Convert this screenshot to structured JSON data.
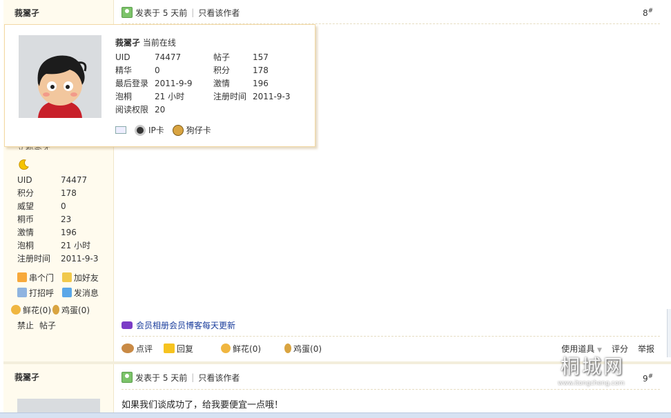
{
  "post1": {
    "author": "莪翯孑",
    "posted": "发表于 5 天前",
    "only_author": "只看该作者",
    "floor_num": "8",
    "floor_mark": "#",
    "cut_text": "丈都秀才",
    "stats": [
      {
        "k": "UID",
        "v": "74477"
      },
      {
        "k": "积分",
        "v": "178"
      },
      {
        "k": "威望",
        "v": "0"
      },
      {
        "k": "桐币",
        "v": "23"
      },
      {
        "k": "激情",
        "v": "196"
      },
      {
        "k": "泡桐",
        "v": "21 小时"
      },
      {
        "k": "注册时间",
        "v": "2011-9-3"
      }
    ],
    "actions": {
      "visit": "串个门",
      "add_friend": "加好友",
      "greet": "打招呼",
      "message": "发消息",
      "flower": "鲜花(0)",
      "egg": "鸡蛋(0)",
      "ban": "禁止",
      "posts": "帖子"
    },
    "ad_text": "会员相册会员博客每天更新",
    "bottom": {
      "comment": "点评",
      "reply": "回复",
      "flower": "鲜花(0)",
      "egg": "鸡蛋(0)",
      "use_tool": "使用道具",
      "rate": "评分",
      "report": "举报"
    }
  },
  "popup": {
    "name": "莪翯孑",
    "status": "当前在线",
    "rows": [
      {
        "k1": "UID",
        "v1": "74477",
        "k2": "帖子",
        "v2": "157"
      },
      {
        "k1": "精华",
        "v1": "0",
        "k2": "积分",
        "v2": "178"
      },
      {
        "k1": "最后登录",
        "v1": "2011-9-9",
        "k2": "激情",
        "v2": "196"
      },
      {
        "k1": "泡桐",
        "v1": "21 小时",
        "k2": "注册时间",
        "v2": "2011-9-3"
      },
      {
        "k1": "阅读权限",
        "v1": "20",
        "k2": "",
        "v2": ""
      }
    ],
    "ip_card": "IP卡",
    "dog_card": "狗仔卡"
  },
  "post2": {
    "author": "莪翯孑",
    "posted": "发表于 5 天前",
    "only_author": "只看该作者",
    "floor_num": "9",
    "floor_mark": "#",
    "message": "如果我们谈成功了，给我要便宜一点哦！"
  },
  "watermark": {
    "text": "桐城网",
    "url": "www.itongcheng.com"
  },
  "colors": {
    "sidebar_bg": "#fffbee",
    "link_blue": "#1a3d9c",
    "popup_border": "#f2d8a4"
  }
}
